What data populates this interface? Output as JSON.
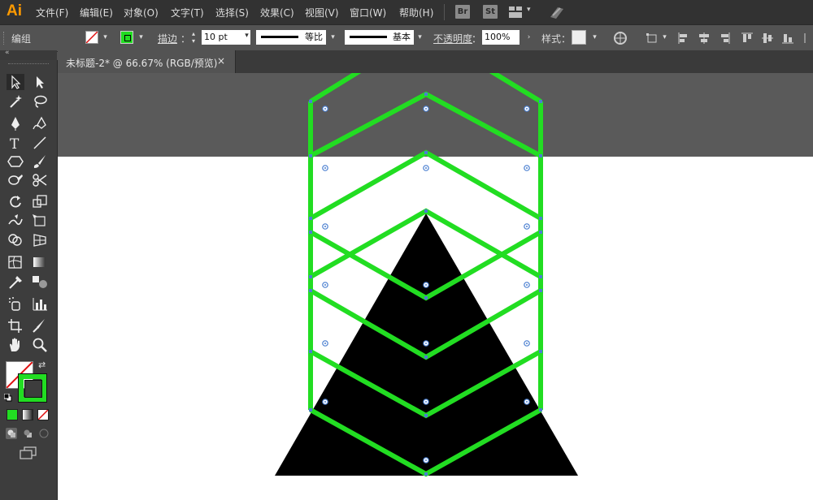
{
  "app": {
    "logo": "Ai"
  },
  "menu": [
    "文件(F)",
    "编辑(E)",
    "对象(O)",
    "文字(T)",
    "选择(S)",
    "效果(C)",
    "视图(V)",
    "窗口(W)",
    "帮助(H)"
  ],
  "bridge": {
    "br": "Br",
    "st": "St"
  },
  "control_bar": {
    "selection_label": "编组",
    "stroke_label": "描边",
    "stroke_weight": "10 pt",
    "profile_label": "等比",
    "brush_label": "基本",
    "opacity_label": "不透明度",
    "opacity_value": "100%",
    "style_label": "样式",
    "colon": "："
  },
  "document": {
    "tab_title": "未标题-2* @ 66.67% (RGB/预览)",
    "close": "×"
  },
  "colors": {
    "accent_stroke": "#22dd22",
    "triangle": "#000000",
    "anchor": "#4a7fd0"
  },
  "icons": [
    "selection-tool-icon",
    "direct-selection-tool-icon",
    "magic-wand-icon",
    "lasso-icon",
    "pen-icon",
    "curvature-icon",
    "type-icon",
    "line-icon",
    "shape-icon",
    "paintbrush-icon",
    "shaper-icon",
    "scissors-icon",
    "rotate-icon",
    "scale-icon",
    "warp-icon",
    "free-transform-icon",
    "shape-builder-icon",
    "perspective-icon",
    "mesh-icon",
    "gradient-icon",
    "eyedropper-icon",
    "blend-icon",
    "symbol-sprayer-icon",
    "graph-icon",
    "artboard-icon",
    "slice-icon",
    "hand-icon",
    "zoom-icon"
  ]
}
